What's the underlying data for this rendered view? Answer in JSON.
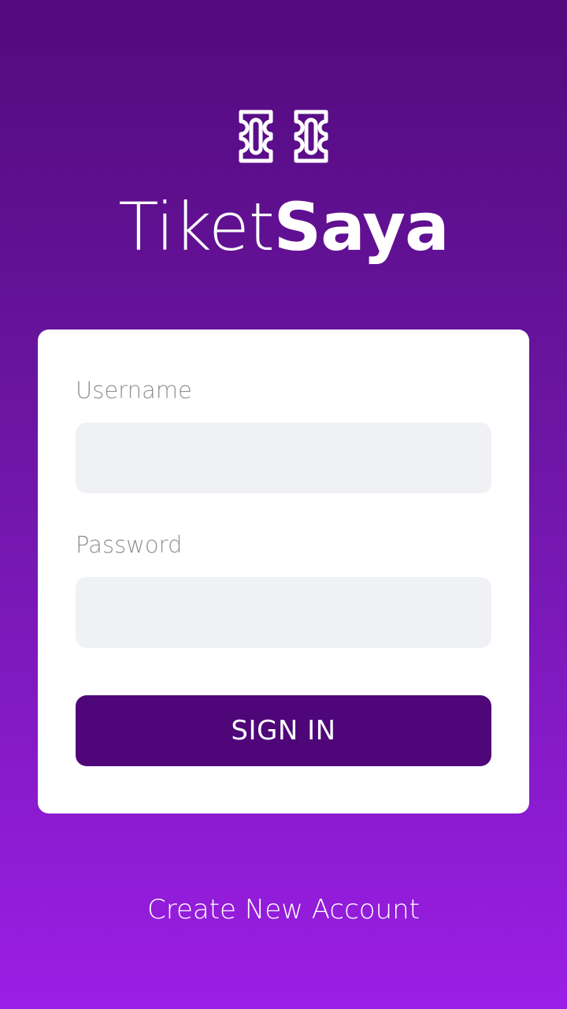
{
  "brand": {
    "name_light": "Tiket",
    "name_bold": "Saya",
    "logo_icon": "two-tickets-icon"
  },
  "login_form": {
    "username_label": "Username",
    "username_value": "",
    "password_label": "Password",
    "password_value": "",
    "sign_in_label": "SIGN IN"
  },
  "footer": {
    "create_account_label": "Create New Account"
  },
  "colors": {
    "background_top": "#520a7c",
    "background_bottom": "#9b1ee6",
    "button": "#4e0679",
    "input_bg": "#f0f1f5"
  }
}
